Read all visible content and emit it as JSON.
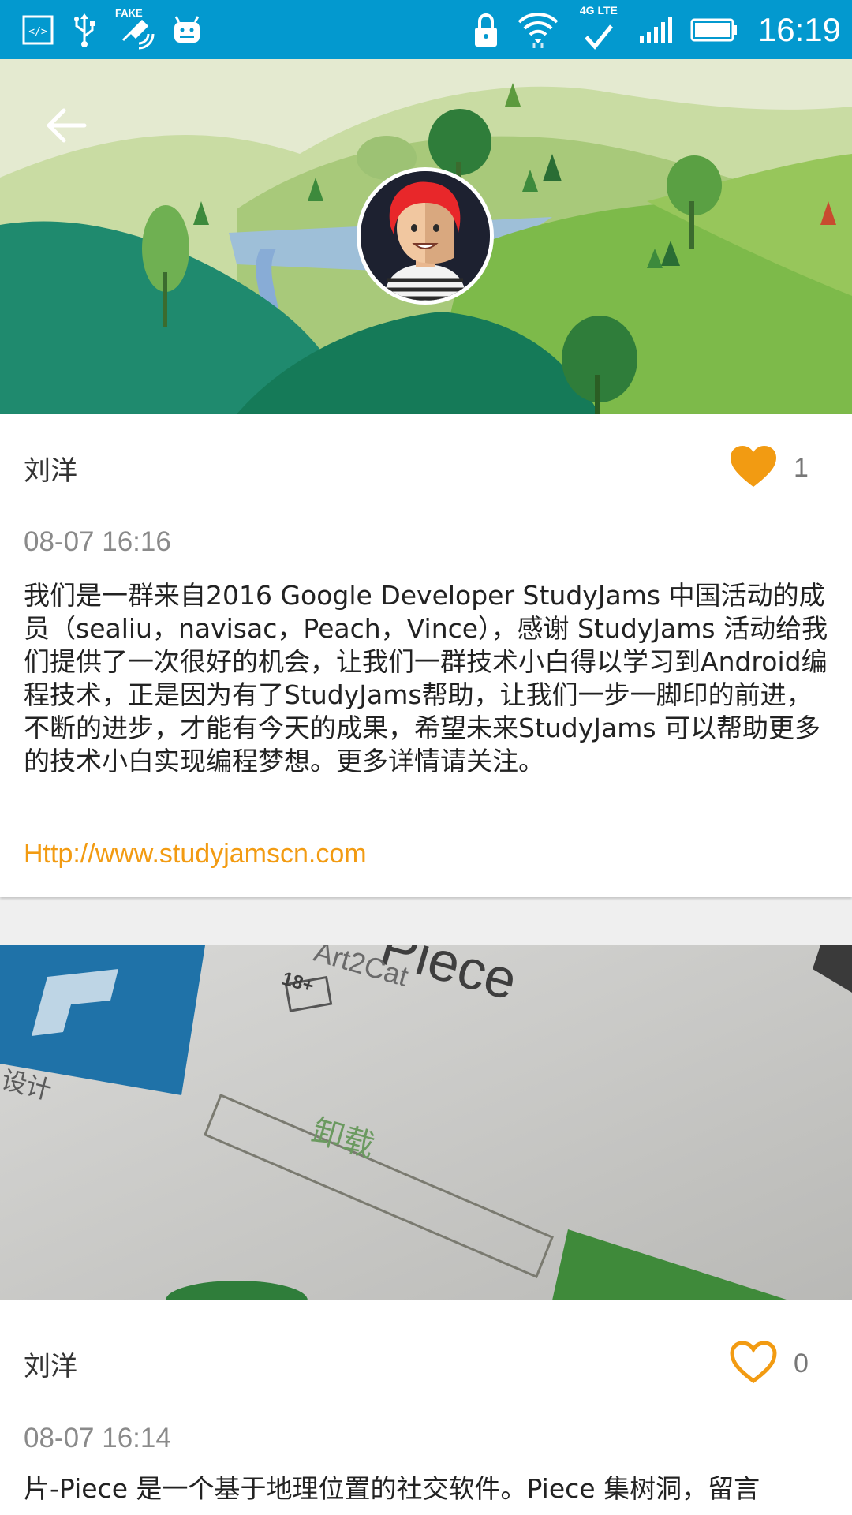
{
  "status_bar": {
    "time": "16:19",
    "fake_tag": "FAKE",
    "network_tag": "4G LTE",
    "icons": [
      "code-icon",
      "usb-icon",
      "gps-icon",
      "android-icon",
      "lock-icon",
      "wifi-icon",
      "check-icon",
      "signal-icon",
      "battery-icon"
    ]
  },
  "colors": {
    "status_bar": "#0399cf",
    "accent_orange": "#f29b12",
    "link": "#f29b12"
  },
  "posts": [
    {
      "author": "刘洋",
      "like_count": "1",
      "liked": true,
      "time": "08-07 16:16",
      "text": "我们是一群来自2016 Google Developer StudyJams 中国活动的成员（sealiu，navisac，Peach，Vince），感谢 StudyJams 活动给我们提供了一次很好的机会，让我们一群技术小白得以学习到Android编程技术，正是因为有了StudyJams帮助，让我们一步一脚印的前进，不断的进步，才能有今天的成果，希望未来StudyJams 可以帮助更多的技术小白实现编程梦想。更多详情请关注。",
      "link": "Http://www.studyjamscn.com"
    },
    {
      "author": "刘洋",
      "like_count": "0",
      "liked": false,
      "time": "08-07 16:14",
      "text": "片-Piece 是一个基于地理位置的社交软件。Piece 集树洞，留言",
      "photo_texts": {
        "app_name": "Piece",
        "developer": "Art2Cat",
        "rating": "18+",
        "button": "卸载",
        "side": "设计"
      }
    }
  ]
}
